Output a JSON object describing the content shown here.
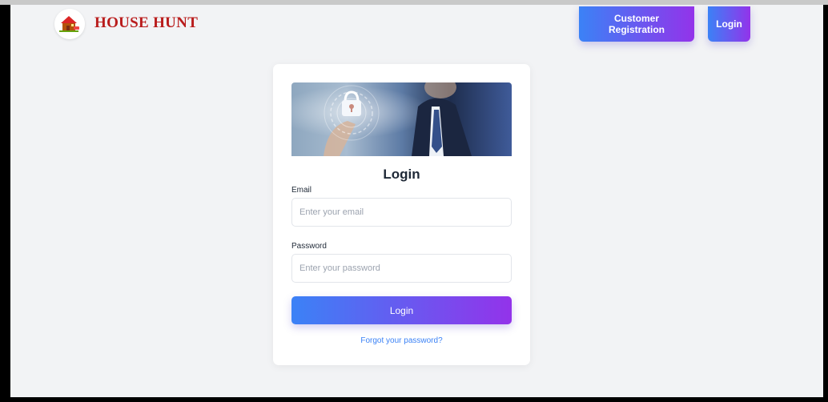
{
  "header": {
    "brand_name": "HOUSE HUNT",
    "logo_icon": "house-logo-icon",
    "nav": {
      "register_label": "Customer Registration",
      "login_label": "Login"
    }
  },
  "login_card": {
    "hero_image": "padlock-fingerprint-image",
    "title": "Login",
    "email": {
      "label": "Email",
      "placeholder": "Enter your email",
      "value": ""
    },
    "password": {
      "label": "Password",
      "placeholder": "Enter your password",
      "value": ""
    },
    "submit_label": "Login",
    "forgot_label": "Forgot your password?"
  },
  "colors": {
    "brand": "#b91c1c",
    "gradient_start": "#3b82f6",
    "gradient_end": "#9333ea",
    "page_background": "#f2f3f5",
    "link": "#3b82f6"
  }
}
